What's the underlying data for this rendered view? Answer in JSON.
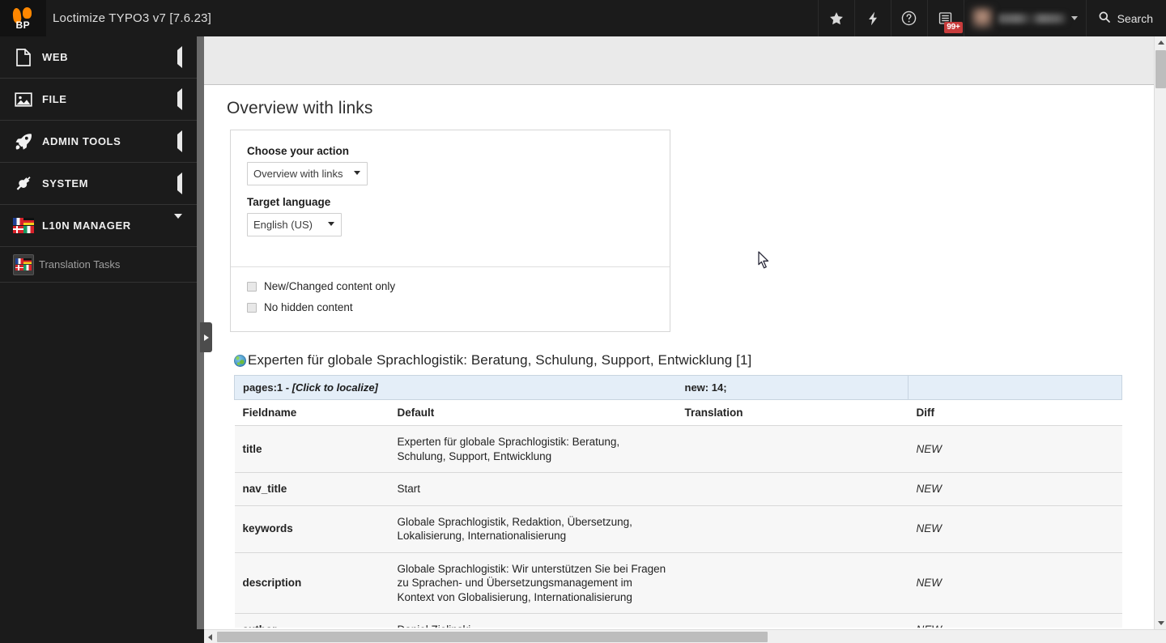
{
  "topbar": {
    "app_title": "Loctimize TYPO3 v7 [7.6.23]",
    "logo_text": "BP",
    "buttons": [
      {
        "name": "bookmark",
        "icon": "star-icon"
      },
      {
        "name": "flash",
        "icon": "lightning-icon"
      },
      {
        "name": "help",
        "icon": "question-circle-icon"
      },
      {
        "name": "systeminformation",
        "icon": "list-icon",
        "badge": "99+"
      }
    ],
    "user_menu_label": "",
    "search_label": "Search"
  },
  "sidebar": {
    "items": [
      {
        "label": "WEB",
        "icon": "page-icon",
        "state": "collapsed"
      },
      {
        "label": "FILE",
        "icon": "image-icon",
        "state": "collapsed"
      },
      {
        "label": "ADMIN TOOLS",
        "icon": "rocket-icon",
        "state": "collapsed"
      },
      {
        "label": "SYSTEM",
        "icon": "plug-icon",
        "state": "collapsed"
      },
      {
        "label": "L10N MANAGER",
        "icon": "flags-icon",
        "state": "expanded"
      }
    ],
    "subitems": [
      {
        "label": "Translation Tasks",
        "icon": "flags-icon",
        "active": true
      }
    ]
  },
  "main": {
    "page_heading": "Overview with links",
    "panel": {
      "action_label": "Choose your action",
      "action_value": "Overview with links",
      "action_options": [
        "Overview with links"
      ],
      "language_label": "Target language",
      "language_value": "English (US)",
      "language_options": [
        "English (US)"
      ],
      "checkboxes": [
        {
          "label": "New/Changed content only",
          "checked": false
        },
        {
          "label": "No hidden content",
          "checked": false
        }
      ]
    },
    "result": {
      "heading": "Experten für globale Sprachlogistik: Beratung, Schulung, Support, Entwicklung [1]",
      "heading_icon": "globe-icon",
      "summary_left": "pages:1 - ",
      "summary_left_action": "[Click to localize]",
      "summary_right": "new: 14;",
      "columns": [
        "Fieldname",
        "Default",
        "Translation",
        "Diff"
      ],
      "rows": [
        {
          "fieldname": "title",
          "default": "Experten für globale Sprachlogistik: Beratung, Schulung, Support, Entwicklung",
          "translation": "",
          "diff": "NEW"
        },
        {
          "fieldname": "nav_title",
          "default": "Start",
          "translation": "",
          "diff": "NEW"
        },
        {
          "fieldname": "keywords",
          "default": "Globale Sprachlogistik, Redaktion, Übersetzung, Lokalisierung, Internationalisierung",
          "translation": "",
          "diff": "NEW"
        },
        {
          "fieldname": "description",
          "default": "Globale Sprachlogistik: Wir unterstützen Sie bei Fragen zu Sprachen- und Übersetzungsmanagement im Kontext von Globalisierung, Internationalisierung",
          "translation": "",
          "diff": "NEW"
        },
        {
          "fieldname": "author",
          "default": "Daniel Zielinski",
          "translation": "",
          "diff": "NEW"
        }
      ]
    }
  },
  "colors": {
    "topbar_bg": "#1b1b1b",
    "sidebar_bg": "#1b1b1b",
    "accent_orange": "#ff8700",
    "badge_red": "#c83c3c",
    "summary_row_bg": "#e4eef8",
    "row_bg": "#f7f7f7"
  }
}
